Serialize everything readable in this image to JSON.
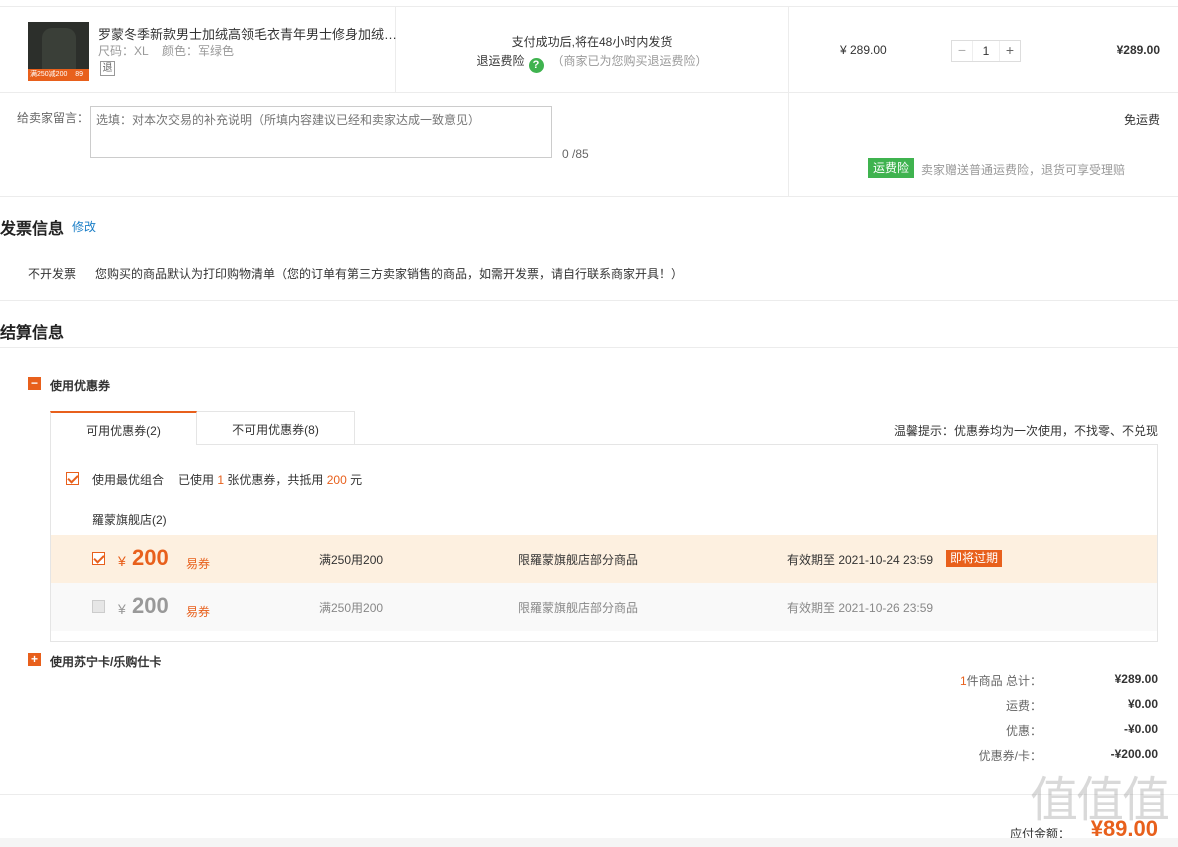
{
  "product": {
    "title": "罗蒙冬季新款男士加绒高领毛衣青年男士修身加绒…",
    "size": "尺码：XL",
    "color": "颜色：军绿色",
    "return_badge": "退",
    "thumb_tag_left": "满250减200",
    "thumb_tag_right": "89",
    "ship_text": "支付成功后,将在48小时内发货",
    "insurance_label": "退运费险",
    "insurance_note": "（商家已为您购买退运费险）",
    "unit_price": "¥ 289.00",
    "quantity": "1",
    "line_total": "¥289.00"
  },
  "message": {
    "label": "给卖家留言：",
    "placeholder": "选填：对本次交易的补充说明（所填内容建议已经和卖家达成一致意见）",
    "count": "0 /85",
    "free_shipping": "免运费",
    "insurance_badge": "运费险",
    "insurance_desc": "卖家赠送普通运费险，退货可享受理赔"
  },
  "invoice": {
    "title": "发票信息",
    "edit": "修改",
    "type": "不开发票",
    "desc": "您购买的商品默认为打印购物清单（您的订单有第三方卖家销售的商品，如需开发票，请自行联系商家开具！）"
  },
  "settlement": {
    "title": "结算信息",
    "coupon_toggle": "使用优惠券",
    "coupon_toggle_symbol": "−",
    "tabs": [
      {
        "label": "可用优惠券(2)"
      },
      {
        "label": "不可用优惠券(8)"
      }
    ],
    "tip": "温馨提示：优惠券均为一次使用，不找零、不兑现",
    "best_combo": "使用最优组合",
    "used_prefix": "已使用",
    "used_count": "1",
    "used_mid": "张优惠券，共抵用",
    "used_amount": "200",
    "used_suffix": "元",
    "store": "羅蒙旗舰店(2)",
    "coupons": [
      {
        "yen": "¥",
        "amount": "200",
        "kind": "易券",
        "condition": "满250用200",
        "scope": "限羅蒙旗舰店部分商品",
        "expiry": "有效期至 2021-10-24 23:59",
        "badge": "即将过期"
      },
      {
        "yen": "¥",
        "amount": "200",
        "kind": "易券",
        "condition": "满250用200",
        "scope": "限羅蒙旗舰店部分商品",
        "expiry": "有效期至 2021-10-26 23:59"
      }
    ],
    "card_toggle": "使用苏宁卡/乐购仕卡",
    "card_toggle_symbol": "+"
  },
  "totals": {
    "count": "1",
    "count_label": "件商品 总计：",
    "subtotal": "¥289.00",
    "shipping_label": "运费：",
    "shipping": "¥0.00",
    "discount_label": "优惠：",
    "discount": "-¥0.00",
    "coupon_label": "优惠券/卡：",
    "coupon": "-¥200.00",
    "pay_label": "应付金额：",
    "pay_amount": "¥89.00"
  },
  "watermark": "值值值"
}
